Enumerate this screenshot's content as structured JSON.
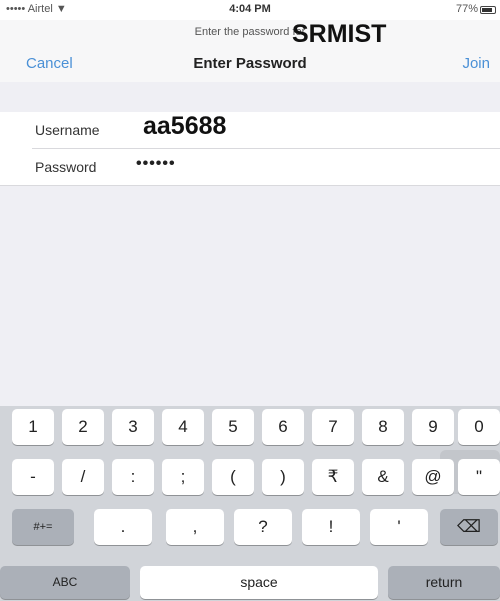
{
  "status_bar": {
    "carrier": "••••• Airtel ▼",
    "time": "4:04 PM",
    "battery": "77%"
  },
  "nav": {
    "prompt": "Enter the password for",
    "network_name": "SRMIST",
    "cancel_label": "Cancel",
    "title": "Enter Password",
    "join_label": "Join"
  },
  "form": {
    "username_label": "Username",
    "username_value": "aa5688",
    "password_label": "Password",
    "password_value": "••••••"
  },
  "keyboard": {
    "row1": [
      "1",
      "2",
      "3",
      "4",
      "5",
      "6",
      "7",
      "8",
      "9",
      "0"
    ],
    "row2": [
      "-",
      "/",
      ":",
      ";",
      "(",
      ")",
      "₹",
      "&",
      "@",
      "\""
    ],
    "row3_toggle": "#+=",
    "row3": [
      ".",
      ",",
      "?",
      "!",
      "'"
    ],
    "delete_glyph": "⌫",
    "abc_label": "ABC",
    "space_label": "space",
    "return_label": "return"
  }
}
